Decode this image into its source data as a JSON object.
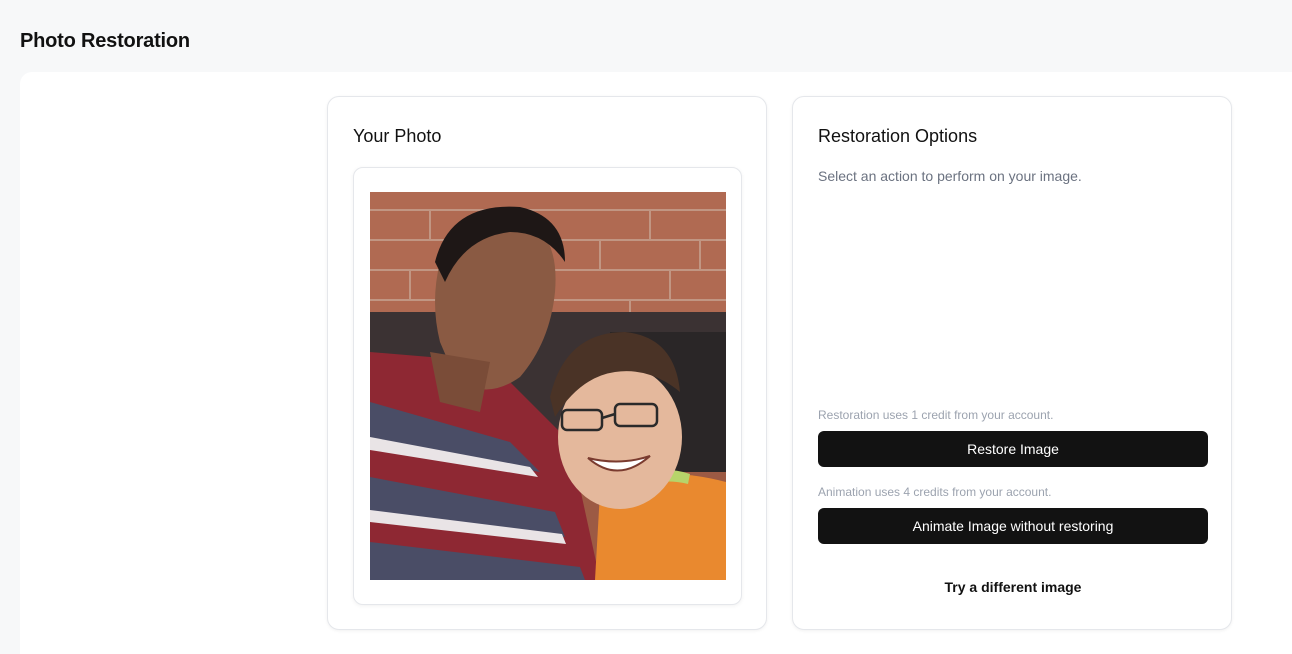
{
  "page": {
    "title": "Photo Restoration"
  },
  "photo_card": {
    "heading": "Your Photo",
    "image_alt": "Uploaded photo"
  },
  "options_card": {
    "heading": "Restoration Options",
    "subtitle": "Select an action to perform on your image.",
    "restore_note": "Restoration uses 1 credit from your account.",
    "restore_label": "Restore Image",
    "animate_note": "Animation uses 4 credits from your account.",
    "animate_label": "Animate Image without restoring",
    "try_different_label": "Try a different image"
  },
  "colors": {
    "button_bg": "#121212",
    "button_text": "#ffffff",
    "muted_text": "#6b7280",
    "note_text": "#9ca3af",
    "border": "#e5e7eb"
  }
}
